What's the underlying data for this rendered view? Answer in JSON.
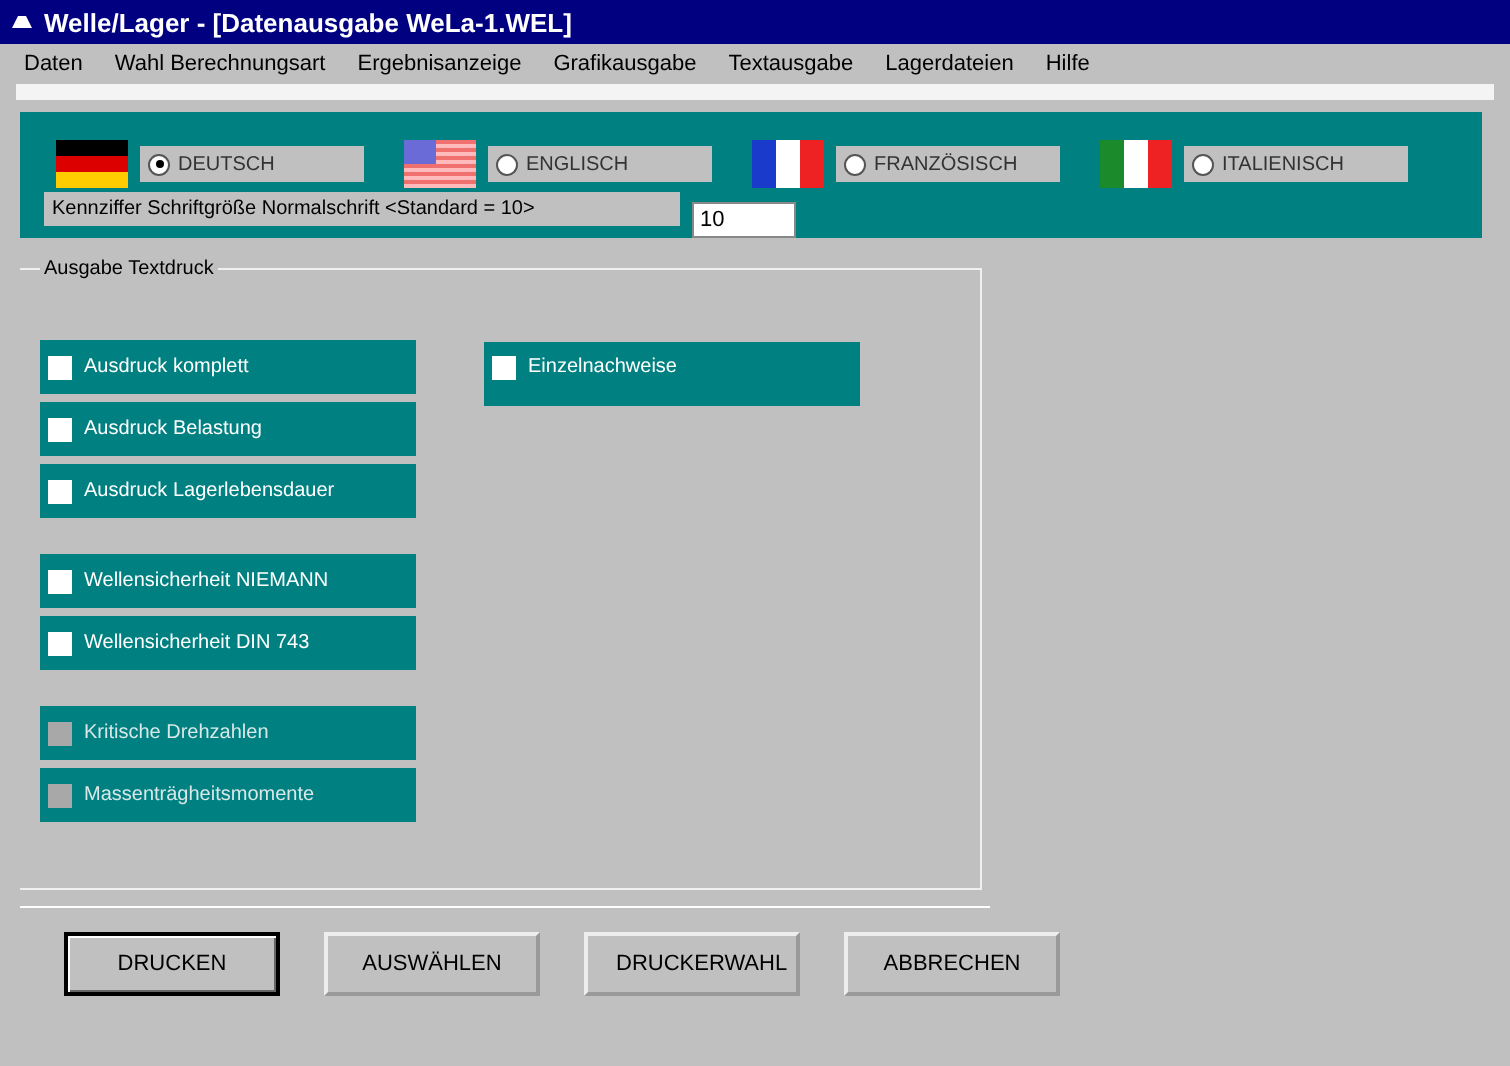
{
  "window": {
    "title": "Welle/Lager - [Datenausgabe WeLa-1.WEL]"
  },
  "menu": [
    {
      "label": "Daten",
      "disabled": false
    },
    {
      "label": "Wahl Berechnungsart",
      "disabled": false
    },
    {
      "label": "Ergebnisanzeige",
      "disabled": false
    },
    {
      "label": "Grafikausgabe",
      "disabled": false
    },
    {
      "label": "Textausgabe",
      "disabled": false
    },
    {
      "label": "Lagerdateien",
      "disabled": false
    },
    {
      "label": "Hilfe",
      "disabled": false
    }
  ],
  "languages": [
    {
      "label": "DEUTSCH",
      "selected": true
    },
    {
      "label": "ENGLISCH",
      "selected": false
    },
    {
      "label": "FRANZÖSISCH",
      "selected": false
    },
    {
      "label": "ITALIENISCH",
      "selected": false
    }
  ],
  "font_size": {
    "label": "Kennziffer Schriftgröße Normalschrift <Standard = 10>",
    "value": "10"
  },
  "group": {
    "title": "Ausgabe Textdruck"
  },
  "left_options": [
    [
      {
        "label": "Ausdruck komplett",
        "checked": false,
        "disabled": false
      },
      {
        "label": "Ausdruck Belastung",
        "checked": false,
        "disabled": false
      },
      {
        "label": "Ausdruck Lagerlebensdauer",
        "checked": false,
        "disabled": false
      }
    ],
    [
      {
        "label": "Wellensicherheit NIEMANN",
        "checked": false,
        "disabled": false
      },
      {
        "label": "Wellensicherheit DIN 743",
        "checked": false,
        "disabled": false
      }
    ],
    [
      {
        "label": "Kritische Drehzahlen",
        "checked": false,
        "disabled": true
      },
      {
        "label": "Massenträgheitsmomente",
        "checked": false,
        "disabled": true
      }
    ]
  ],
  "right_options": [
    {
      "label": "Einzelnachweise",
      "checked": false,
      "disabled": false
    }
  ],
  "buttons": [
    {
      "label": "DRUCKEN",
      "default": true
    },
    {
      "label": "AUSWÄHLEN",
      "default": false
    },
    {
      "label": "DRUCKERWAHL",
      "default": false
    },
    {
      "label": "ABBRECHEN",
      "default": false
    }
  ]
}
